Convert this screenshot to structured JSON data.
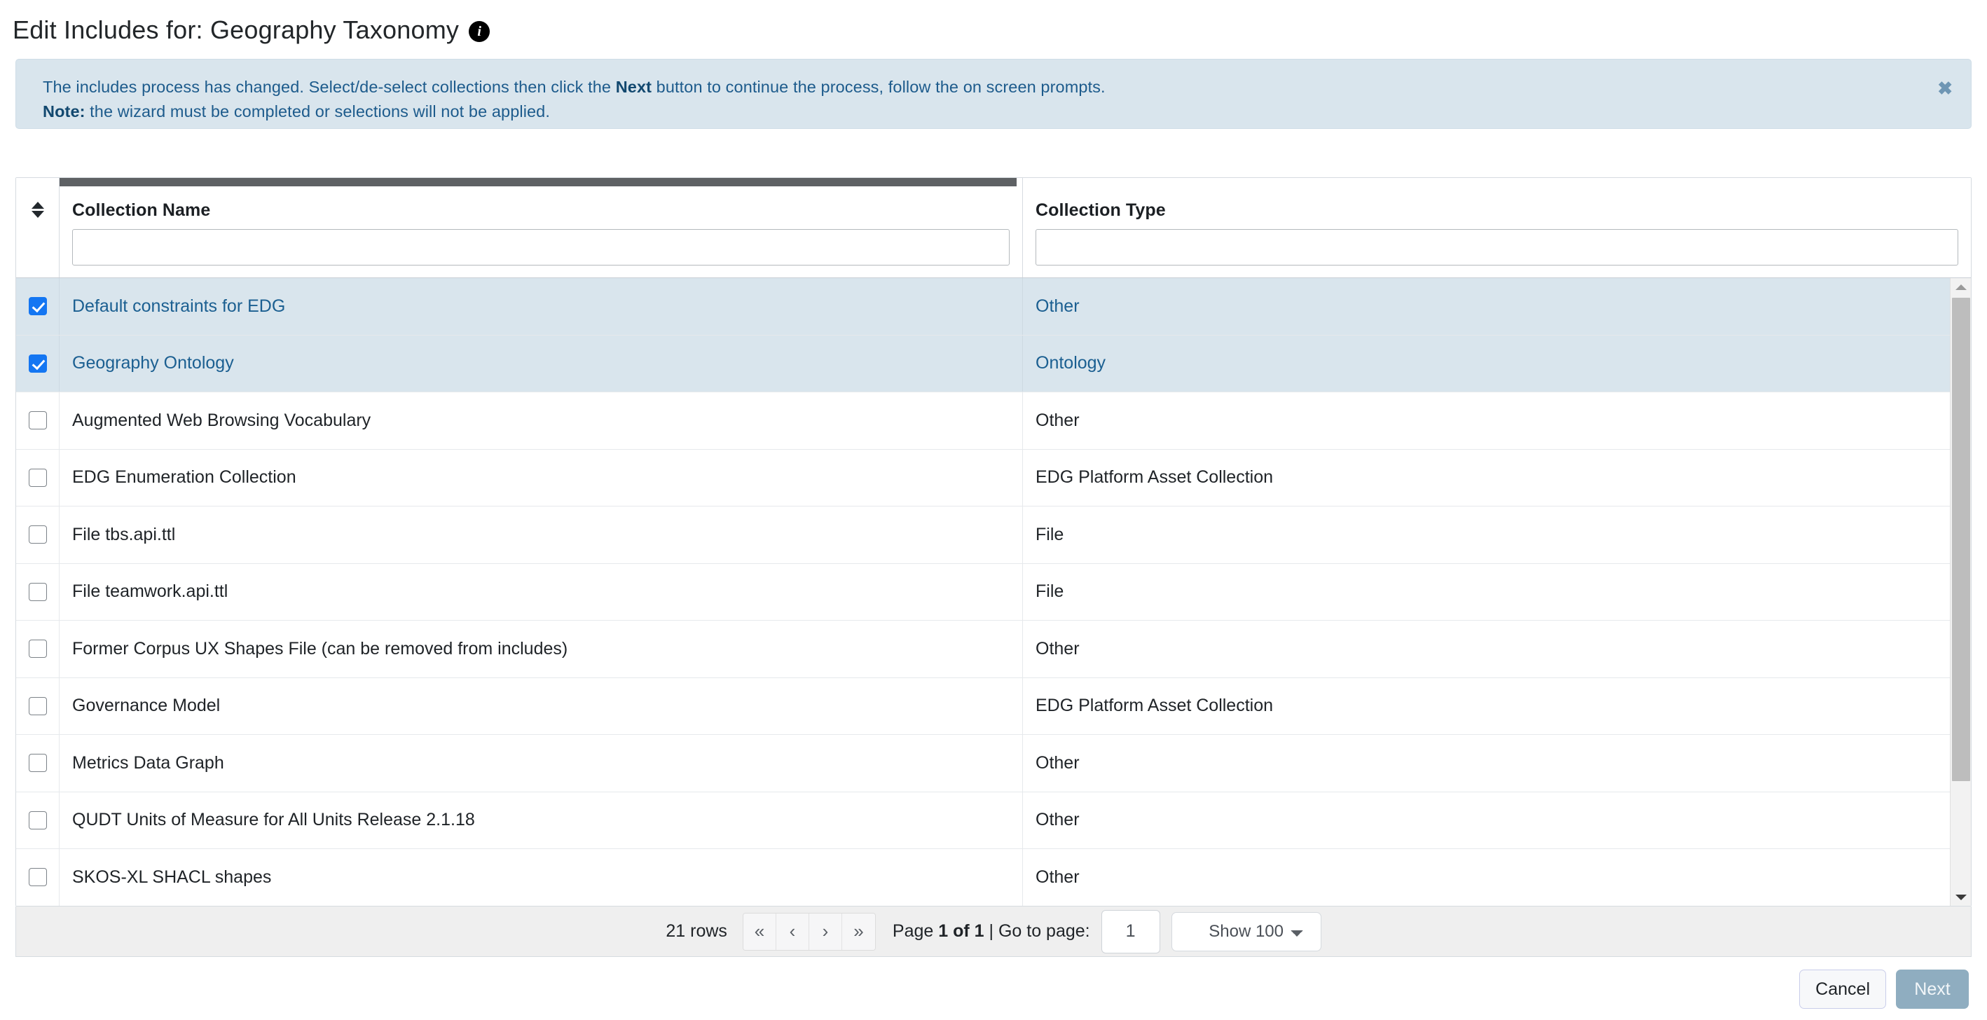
{
  "header": {
    "title": "Edit Includes for: Geography Taxonomy",
    "info_icon": "info-icon"
  },
  "alert": {
    "line1_part1": "The includes process has changed. Select/de-select collections then click the ",
    "line1_bold": "Next",
    "line1_part2": " button to continue the process, follow the on screen prompts.",
    "line2_bold": "Note:",
    "line2_text": " the wizard must be completed or selections will not be applied.",
    "close_label": "✖",
    "bg_color": "#d9e5ed",
    "text_color": "#1d5b8c"
  },
  "table": {
    "columns": [
      {
        "key": "select",
        "label": ""
      },
      {
        "key": "name",
        "label": "Collection Name"
      },
      {
        "key": "type",
        "label": "Collection Type"
      }
    ],
    "filters": {
      "name_value": "",
      "type_value": "",
      "name_placeholder": "",
      "type_placeholder": ""
    },
    "rows": [
      {
        "checked": true,
        "name": "Default constraints for EDG",
        "type": "Other"
      },
      {
        "checked": true,
        "name": "Geography Ontology",
        "type": "Ontology"
      },
      {
        "checked": false,
        "name": "Augmented Web Browsing Vocabulary",
        "type": "Other"
      },
      {
        "checked": false,
        "name": "EDG Enumeration Collection",
        "type": "EDG Platform Asset Collection"
      },
      {
        "checked": false,
        "name": "File tbs.api.ttl",
        "type": "File"
      },
      {
        "checked": false,
        "name": "File teamwork.api.ttl",
        "type": "File"
      },
      {
        "checked": false,
        "name": "Former Corpus UX Shapes File (can be removed from includes)",
        "type": "Other"
      },
      {
        "checked": false,
        "name": "Governance Model",
        "type": "EDG Platform Asset Collection"
      },
      {
        "checked": false,
        "name": "Metrics Data Graph",
        "type": "Other"
      },
      {
        "checked": false,
        "name": "QUDT Units of Measure for All Units Release 2.1.18",
        "type": "Other"
      },
      {
        "checked": false,
        "name": "SKOS-XL SHACL shapes",
        "type": "Other"
      }
    ],
    "selected_row_bg": "#d9e5ed",
    "selected_text_color": "#1b5f91",
    "checkbox_accent": "#1476f2"
  },
  "pagination": {
    "rows_label": "21 rows",
    "first_label": "«",
    "prev_label": "‹",
    "next_label": "›",
    "last_label": "»",
    "page_prefix": "Page ",
    "page_current": "1 of 1",
    "page_suffix": " | Go to page:",
    "goto_value": "1",
    "page_size_label": "Show 100",
    "page_size_options": [
      "Show 100"
    ]
  },
  "footer_actions": {
    "cancel_label": "Cancel",
    "next_label": "Next",
    "next_color": "#8fadc0"
  }
}
